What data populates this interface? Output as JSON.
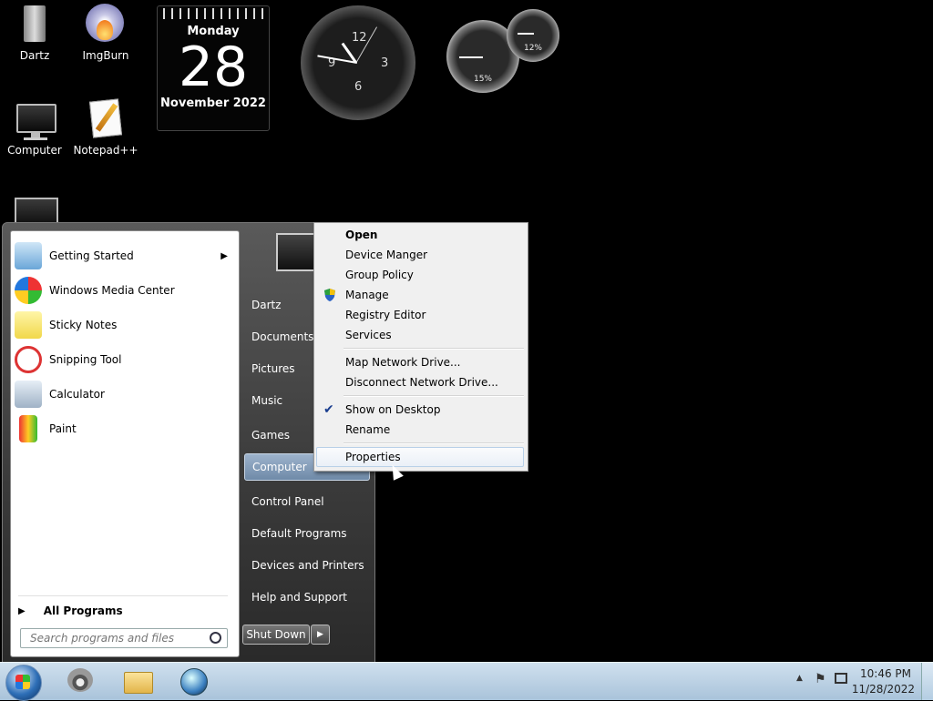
{
  "desktop": {
    "icons": [
      {
        "label": "Dartz",
        "icon": "folder-icon"
      },
      {
        "label": "ImgBurn",
        "icon": "disc-burn-icon"
      },
      {
        "label": "Computer",
        "icon": "computer-icon"
      },
      {
        "label": "Notepad++",
        "icon": "notepad-icon"
      }
    ]
  },
  "gadgets": {
    "calendar": {
      "day": "Monday",
      "date": "28",
      "month": "November 2022"
    },
    "clock": {
      "numerals": [
        "12",
        "3",
        "6",
        "9"
      ]
    },
    "cpu_meter": {
      "cpu": "15%",
      "memory": "12%"
    }
  },
  "start_menu": {
    "programs": [
      {
        "label": "Getting Started",
        "icon": "getting-started-icon",
        "has_submenu": true
      },
      {
        "label": "Windows Media Center",
        "icon": "media-center-icon"
      },
      {
        "label": "Sticky Notes",
        "icon": "sticky-notes-icon"
      },
      {
        "label": "Snipping Tool",
        "icon": "scissors-icon"
      },
      {
        "label": "Calculator",
        "icon": "calculator-icon"
      },
      {
        "label": "Paint",
        "icon": "paint-icon"
      }
    ],
    "all_programs": "All Programs",
    "search_placeholder": "Search programs and files",
    "right_items": [
      "Dartz",
      "Documents",
      "Pictures",
      "Music",
      "Games",
      "Computer",
      "Control Panel",
      "Default Programs",
      "Devices and Printers",
      "Help and Support"
    ],
    "shutdown_label": "Shut Down"
  },
  "context_menu": {
    "items": [
      {
        "label": "Open",
        "bold": true
      },
      {
        "label": "Device Manger"
      },
      {
        "label": "Group Policy"
      },
      {
        "label": "Manage",
        "icon": "uac-shield-icon"
      },
      {
        "label": "Registry Editor"
      },
      {
        "label": "Services"
      },
      {
        "label": "Map Network Drive..."
      },
      {
        "label": "Disconnect Network Drive..."
      },
      {
        "label": "Show on Desktop",
        "checked": true
      },
      {
        "label": "Rename"
      },
      {
        "label": "Properties",
        "hovered": true
      }
    ]
  },
  "taskbar": {
    "pinned": [
      "raccoon-app-icon",
      "explorer-folder-icon",
      "globe-icon"
    ],
    "clock_time": "10:46 PM",
    "clock_date": "11/28/2022"
  },
  "colors": {
    "selection": "#6f8aa8",
    "menu_bg": "#f0f0f0",
    "taskbar": "#a9c3da"
  }
}
